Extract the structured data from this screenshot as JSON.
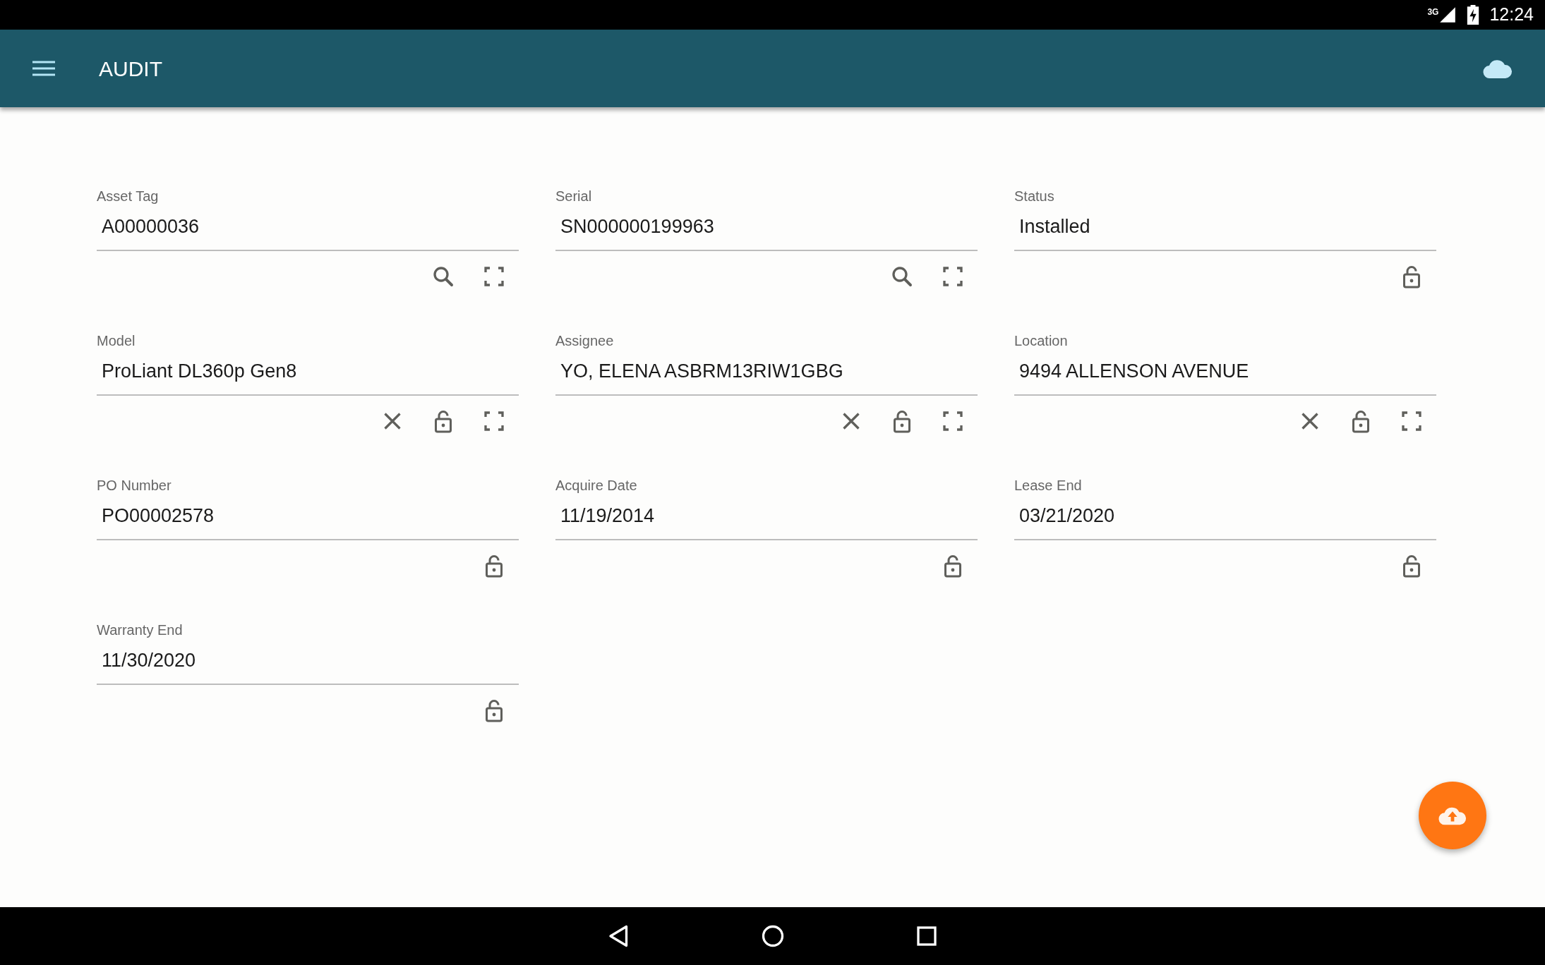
{
  "status_bar": {
    "network": "3G",
    "time": "12:24"
  },
  "app_bar": {
    "title": "AUDIT"
  },
  "fields": [
    {
      "label": "Asset Tag",
      "value": "A00000036",
      "actions": [
        {
          "kind": "search"
        },
        {
          "kind": "scan"
        }
      ]
    },
    {
      "label": "Serial",
      "value": "SN000000199963",
      "actions": [
        {
          "kind": "search"
        },
        {
          "kind": "scan"
        }
      ]
    },
    {
      "label": "Status",
      "value": "Installed",
      "actions": [
        {
          "kind": "lock"
        }
      ]
    },
    {
      "label": "Model",
      "value": "ProLiant DL360p Gen8",
      "actions": [
        {
          "kind": "clear"
        },
        {
          "kind": "lock"
        },
        {
          "kind": "scan"
        }
      ]
    },
    {
      "label": "Assignee",
      "value": "YO, ELENA ASBRM13RIW1GBG",
      "actions": [
        {
          "kind": "clear"
        },
        {
          "kind": "lock"
        },
        {
          "kind": "scan"
        }
      ]
    },
    {
      "label": "Location",
      "value": "9494 ALLENSON AVENUE",
      "actions": [
        {
          "kind": "clear"
        },
        {
          "kind": "lock"
        },
        {
          "kind": "scan"
        }
      ]
    },
    {
      "label": "PO Number",
      "value": "PO00002578",
      "actions": [
        {
          "kind": "lock"
        }
      ]
    },
    {
      "label": "Acquire Date",
      "value": "11/19/2014",
      "actions": [
        {
          "kind": "lock"
        }
      ]
    },
    {
      "label": "Lease End",
      "value": "03/21/2020",
      "actions": [
        {
          "kind": "lock"
        }
      ]
    },
    {
      "label": "Warranty End",
      "value": "11/30/2020",
      "actions": [
        {
          "kind": "lock"
        }
      ]
    }
  ]
}
